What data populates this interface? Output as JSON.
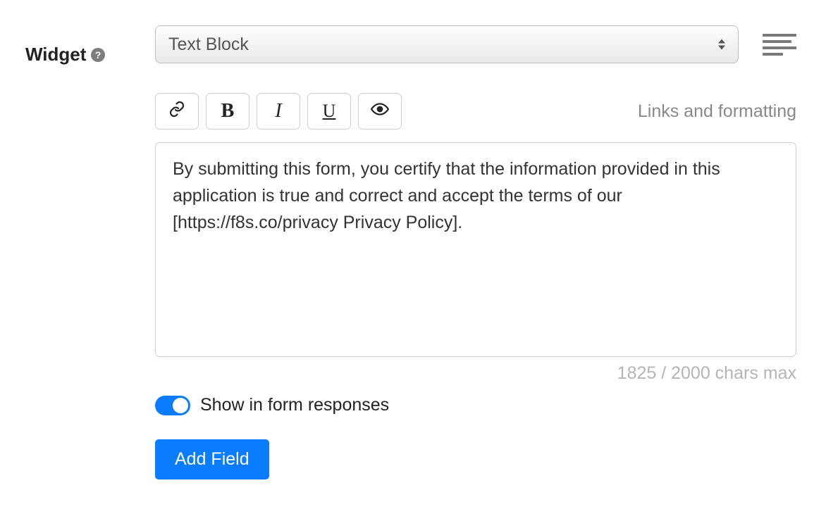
{
  "label": "Widget",
  "widgetSelect": {
    "value": "Text Block"
  },
  "toolbar": {
    "bold": "B",
    "italic": "I",
    "underline": "U"
  },
  "linksHelp": "Links and formatting",
  "content": "By submitting this form, you certify that the information provided in this application is true and correct and accept the terms of our [https://f8s.co/privacy Privacy Policy].",
  "charCount": "1825 / 2000 chars max",
  "toggle": {
    "on": true,
    "label": "Show in form responses"
  },
  "addButton": "Add Field"
}
